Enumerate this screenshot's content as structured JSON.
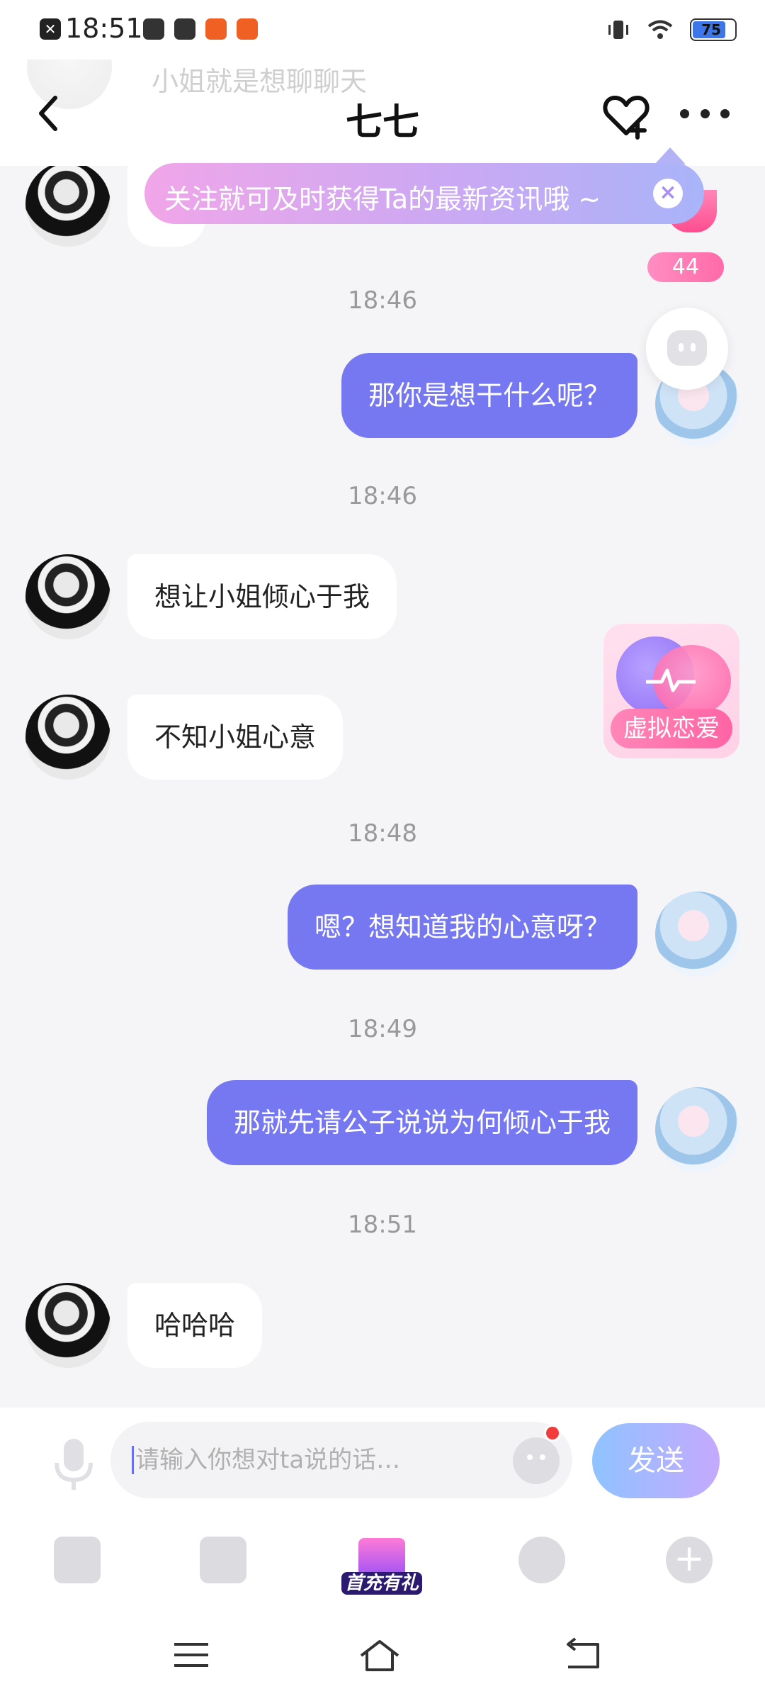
{
  "status_bar": {
    "time": "18:51",
    "battery": "75"
  },
  "header": {
    "title": "七七",
    "faded_preview": "小姐就是想聊聊天"
  },
  "follow_tip": {
    "text": "关注就可及时获得Ta的最新资讯哦 ~"
  },
  "intimacy": {
    "count": "44"
  },
  "feature_card": {
    "label": "虚拟恋爱"
  },
  "messages": [
    {
      "type": "time",
      "text": "18:46"
    },
    {
      "type": "out",
      "text": "那你是想干什么呢？"
    },
    {
      "type": "time",
      "text": "18:46"
    },
    {
      "type": "in",
      "text": "想让小姐倾心于我"
    },
    {
      "type": "in",
      "text": "不知小姐心意"
    },
    {
      "type": "time",
      "text": "18:48"
    },
    {
      "type": "out",
      "text": "嗯？想知道我的心意呀？"
    },
    {
      "type": "time",
      "text": "18:49"
    },
    {
      "type": "out",
      "text": "那就先请公子说说为何倾心于我"
    },
    {
      "type": "time",
      "text": "18:51"
    },
    {
      "type": "in",
      "text": "哈哈哈"
    }
  ],
  "input": {
    "placeholder": "请输入你想对ta说的话…",
    "send_label": "发送"
  },
  "toolbar": {
    "gift_label": "首充有礼"
  },
  "colors": {
    "outgoing_bubble": "#7678f2",
    "incoming_bubble": "#ffffff",
    "background": "#f5f5f7",
    "accent_pink": "#ff64a4"
  }
}
